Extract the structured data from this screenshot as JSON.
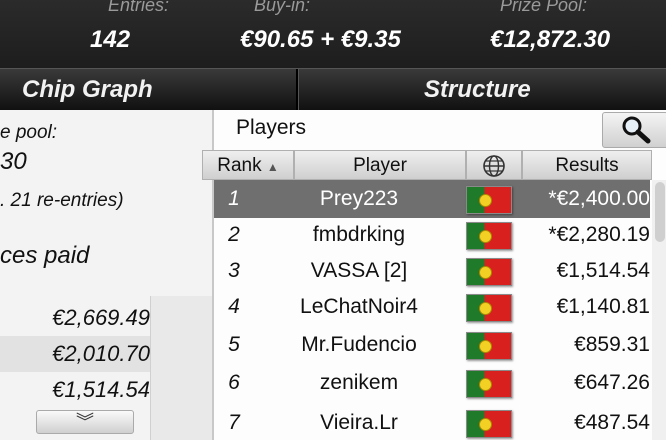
{
  "summary": {
    "entries_label": "Entries:",
    "entries_value": "142",
    "buyin_label": "Buy-in:",
    "buyin_value": "€90.65 + €9.35",
    "prize_label": "Prize Pool:",
    "prize_value": "€12,872.30"
  },
  "tabs": {
    "chip_graph": "Chip Graph",
    "structure": "Structure"
  },
  "left_panel": {
    "pool_label": "e pool:",
    "pool_value": "30",
    "reentries": ". 21 re-entries)",
    "places_paid": "ces paid",
    "payouts": [
      "€2,669.49",
      "€2,010.70",
      "€1,514.54"
    ],
    "expand_glyph": "︾"
  },
  "players": {
    "title": "Players",
    "columns": {
      "rank": "Rank",
      "player": "Player",
      "results": "Results"
    },
    "rows": [
      {
        "rank": "1",
        "name": "Prey223",
        "result": "*€2,400.00",
        "selected": true
      },
      {
        "rank": "2",
        "name": "fmbdrking",
        "result": "*€2,280.19"
      },
      {
        "rank": "3",
        "name": "VASSA [2]",
        "result": "€1,514.54"
      },
      {
        "rank": "4",
        "name": "LeChatNoir4",
        "result": "€1,140.81"
      },
      {
        "rank": "5",
        "name": "Mr.Fudencio",
        "result": "€859.31"
      },
      {
        "rank": "6",
        "name": "zenikem",
        "result": "€647.26"
      },
      {
        "rank": "7",
        "name": "Vieira.Lr",
        "result": "€487.54"
      }
    ]
  },
  "colors": {
    "flag_green": "#1f7a2a",
    "flag_red": "#d8211e",
    "selected_row": "#6f6f6f"
  }
}
